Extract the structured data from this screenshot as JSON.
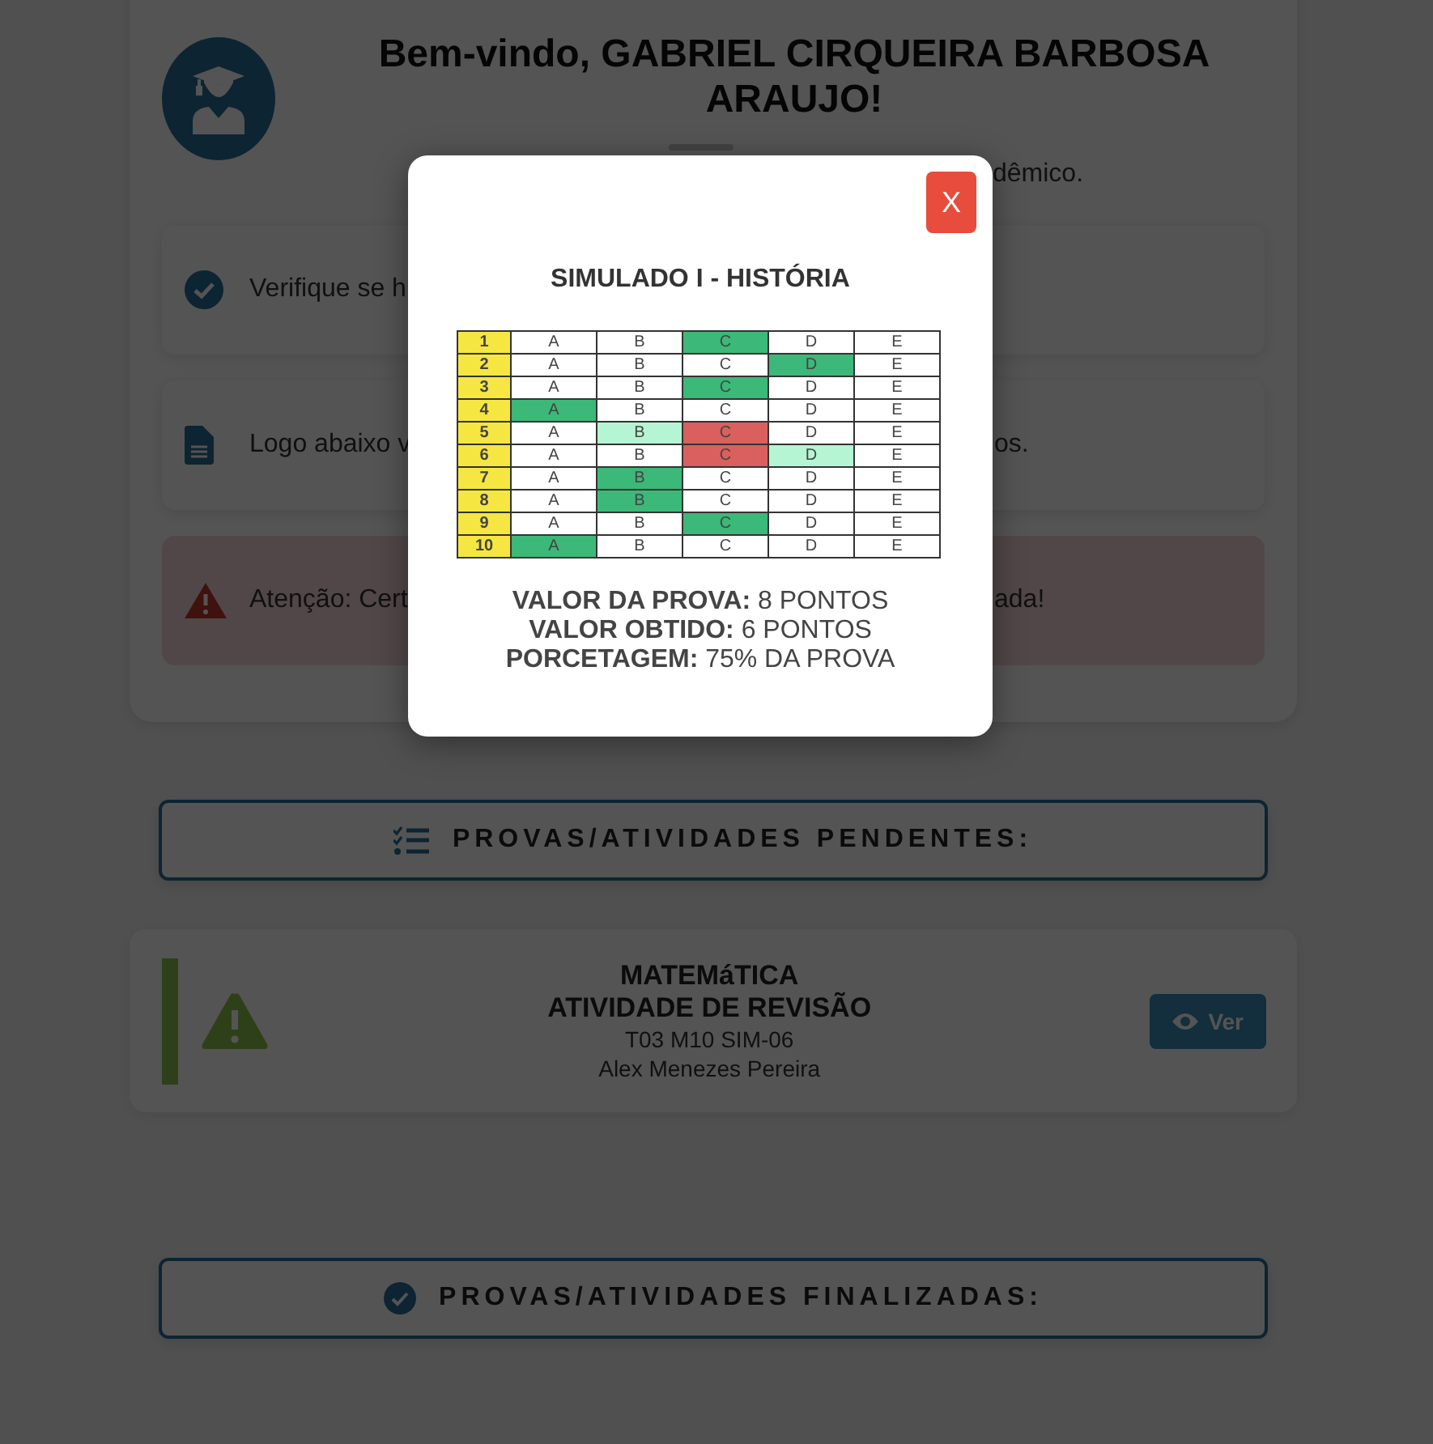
{
  "welcome": {
    "title": "Bem-vindo, GABRIEL CIRQUEIRA BARBOSA ARAUJO!",
    "subtitle_visible": "dêmico."
  },
  "notices": [
    {
      "kind": "check",
      "left": "Verifique se h"
    },
    {
      "kind": "document",
      "left": "Logo abaixo v",
      "right": "os."
    },
    {
      "kind": "warning",
      "left": "Atenção: Cert",
      "right": "ada!"
    }
  ],
  "sections": [
    {
      "kind": "pending",
      "title": "PROVAS/ATIVIDADES PENDENTES:"
    },
    {
      "kind": "done",
      "title": "PROVAS/ATIVIDADES FINALIZADAS:"
    }
  ],
  "pending_items": [
    {
      "subject": "MATEMáTICA",
      "activity": "ATIVIDADE DE REVISÃO",
      "class": "T03 M10 SIM-06",
      "teacher": "Alex Menezes Pereira",
      "button": "Ver"
    }
  ],
  "modal": {
    "close": "X",
    "title": "SIMULADO I - HISTÓRIA",
    "rows": [
      {
        "number": "1",
        "cells": [
          {
            "letter": "A",
            "selected": false,
            "correct": false
          },
          {
            "letter": "B",
            "selected": false,
            "correct": false
          },
          {
            "letter": "C",
            "selected": true,
            "correct": true
          },
          {
            "letter": "D",
            "selected": false,
            "correct": false
          },
          {
            "letter": "E",
            "selected": false,
            "correct": false
          }
        ]
      },
      {
        "number": "2",
        "cells": [
          {
            "letter": "A",
            "selected": false,
            "correct": false
          },
          {
            "letter": "B",
            "selected": false,
            "correct": false
          },
          {
            "letter": "C",
            "selected": false,
            "correct": false
          },
          {
            "letter": "D",
            "selected": true,
            "correct": true
          },
          {
            "letter": "E",
            "selected": false,
            "correct": false
          }
        ]
      },
      {
        "number": "3",
        "cells": [
          {
            "letter": "A",
            "selected": false,
            "correct": false
          },
          {
            "letter": "B",
            "selected": false,
            "correct": false
          },
          {
            "letter": "C",
            "selected": true,
            "correct": true
          },
          {
            "letter": "D",
            "selected": false,
            "correct": false
          },
          {
            "letter": "E",
            "selected": false,
            "correct": false
          }
        ]
      },
      {
        "number": "4",
        "cells": [
          {
            "letter": "A",
            "selected": true,
            "correct": true
          },
          {
            "letter": "B",
            "selected": false,
            "correct": false
          },
          {
            "letter": "C",
            "selected": false,
            "correct": false
          },
          {
            "letter": "D",
            "selected": false,
            "correct": false
          },
          {
            "letter": "E",
            "selected": false,
            "correct": false
          }
        ]
      },
      {
        "number": "5",
        "cells": [
          {
            "letter": "A",
            "selected": false,
            "correct": false
          },
          {
            "letter": "B",
            "selected": false,
            "correct": true
          },
          {
            "letter": "C",
            "selected": true,
            "correct": false
          },
          {
            "letter": "D",
            "selected": false,
            "correct": false
          },
          {
            "letter": "E",
            "selected": false,
            "correct": false
          }
        ]
      },
      {
        "number": "6",
        "cells": [
          {
            "letter": "A",
            "selected": false,
            "correct": false
          },
          {
            "letter": "B",
            "selected": false,
            "correct": false
          },
          {
            "letter": "C",
            "selected": true,
            "correct": false
          },
          {
            "letter": "D",
            "selected": false,
            "correct": true
          },
          {
            "letter": "E",
            "selected": false,
            "correct": false
          }
        ]
      },
      {
        "number": "7",
        "cells": [
          {
            "letter": "A",
            "selected": false,
            "correct": false
          },
          {
            "letter": "B",
            "selected": true,
            "correct": true
          },
          {
            "letter": "C",
            "selected": false,
            "correct": false
          },
          {
            "letter": "D",
            "selected": false,
            "correct": false
          },
          {
            "letter": "E",
            "selected": false,
            "correct": false
          }
        ]
      },
      {
        "number": "8",
        "cells": [
          {
            "letter": "A",
            "selected": false,
            "correct": false
          },
          {
            "letter": "B",
            "selected": true,
            "correct": true
          },
          {
            "letter": "C",
            "selected": false,
            "correct": false
          },
          {
            "letter": "D",
            "selected": false,
            "correct": false
          },
          {
            "letter": "E",
            "selected": false,
            "correct": false
          }
        ]
      },
      {
        "number": "9",
        "cells": [
          {
            "letter": "A",
            "selected": false,
            "correct": false
          },
          {
            "letter": "B",
            "selected": false,
            "correct": false
          },
          {
            "letter": "C",
            "selected": true,
            "correct": true
          },
          {
            "letter": "D",
            "selected": false,
            "correct": false
          },
          {
            "letter": "E",
            "selected": false,
            "correct": false
          }
        ]
      },
      {
        "number": "10",
        "cells": [
          {
            "letter": "A",
            "selected": true,
            "correct": true
          },
          {
            "letter": "B",
            "selected": false,
            "correct": false
          },
          {
            "letter": "C",
            "selected": false,
            "correct": false
          },
          {
            "letter": "D",
            "selected": false,
            "correct": false
          },
          {
            "letter": "E",
            "selected": false,
            "correct": false
          }
        ]
      }
    ],
    "summary": [
      "**VALOR DA PROVA:** 8 PONTOS",
      "**VALOR OBTIDO:** 6 PONTOS",
      "**PORCETAGEM:** 75% DA PROVA"
    ]
  }
}
